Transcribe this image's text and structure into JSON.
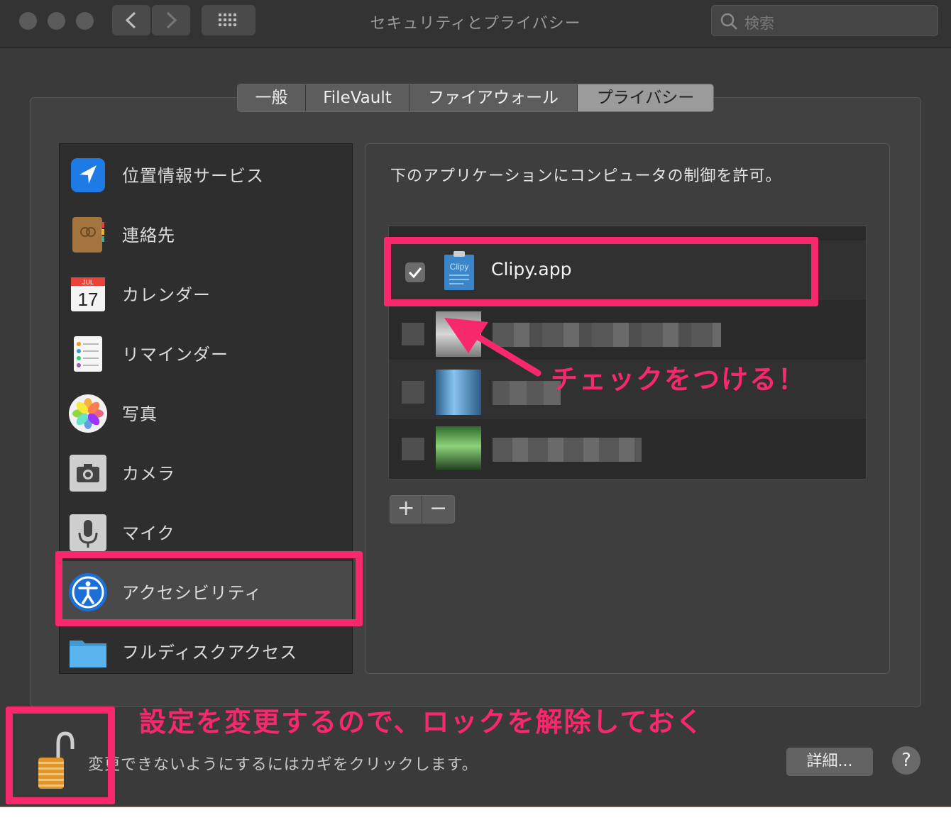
{
  "window": {
    "title": "セキュリティとプライバシー",
    "search_placeholder": "検索"
  },
  "tabs": [
    {
      "label": "一般",
      "active": false
    },
    {
      "label": "FileVault",
      "active": false
    },
    {
      "label": "ファイアウォール",
      "active": false
    },
    {
      "label": "プライバシー",
      "active": true
    }
  ],
  "sidebar": {
    "items": [
      {
        "label": "位置情報サービス",
        "icon": "location-arrow-icon"
      },
      {
        "label": "連絡先",
        "icon": "contacts-book-icon"
      },
      {
        "label": "カレンダー",
        "icon": "calendar-icon",
        "icon_month": "JUL",
        "icon_day": "17"
      },
      {
        "label": "リマインダー",
        "icon": "reminders-icon"
      },
      {
        "label": "写真",
        "icon": "photos-icon"
      },
      {
        "label": "カメラ",
        "icon": "camera-icon"
      },
      {
        "label": "マイク",
        "icon": "microphone-icon"
      },
      {
        "label": "アクセシビリティ",
        "icon": "accessibility-icon",
        "selected": true
      },
      {
        "label": "フルディスクアクセス",
        "icon": "folder-icon"
      }
    ]
  },
  "detail": {
    "heading": "下のアプリケーションにコンピュータの制御を許可。",
    "apps": [
      {
        "name": "Clipy.app",
        "checked": true,
        "icon_text": "Clipy"
      }
    ],
    "add_label": "+",
    "remove_label": "−"
  },
  "footer": {
    "lock_text": "変更できないようにするにはカギをクリックします。",
    "advanced_label": "詳細...",
    "help_label": "?"
  },
  "annotations": {
    "check_note": "チェックをつける！",
    "unlock_note": "設定を変更するので、ロックを解除しておく"
  },
  "colors": {
    "highlight": "#f8286c",
    "window_bg": "#3b3a3a"
  }
}
